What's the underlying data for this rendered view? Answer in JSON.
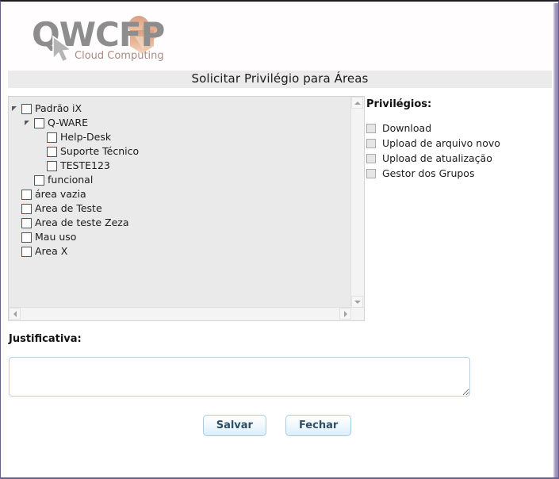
{
  "page": {
    "title": "Solicitar Privilégio para Áreas"
  },
  "logo": {
    "brand_text": "QWCFP",
    "tagline": "Cloud Computing",
    "name": "qwcfp-cloud-computing-logo"
  },
  "tree": {
    "name": "areas-tree",
    "items": [
      {
        "label": "Padrão iX",
        "depth": 0,
        "expandable": true,
        "expanded": true,
        "checked": false
      },
      {
        "label": "Q-WARE",
        "depth": 1,
        "expandable": true,
        "expanded": true,
        "checked": false
      },
      {
        "label": "Help-Desk",
        "depth": 2,
        "expandable": false,
        "expanded": false,
        "checked": false
      },
      {
        "label": "Suporte Técnico",
        "depth": 2,
        "expandable": false,
        "expanded": false,
        "checked": false
      },
      {
        "label": "TESTE123",
        "depth": 2,
        "expandable": false,
        "expanded": false,
        "checked": false
      },
      {
        "label": "funcional",
        "depth": 1,
        "expandable": false,
        "expanded": false,
        "checked": false
      },
      {
        "label": "área vazia",
        "depth": 0,
        "expandable": false,
        "expanded": false,
        "checked": false
      },
      {
        "label": "Area de Teste",
        "depth": 0,
        "expandable": false,
        "expanded": false,
        "checked": false
      },
      {
        "label": "Area de teste Zeza",
        "depth": 0,
        "expandable": false,
        "expanded": false,
        "checked": false
      },
      {
        "label": "Mau uso",
        "depth": 0,
        "expandable": false,
        "expanded": false,
        "checked": false
      },
      {
        "label": "Area X",
        "depth": 0,
        "expandable": false,
        "expanded": false,
        "checked": false
      }
    ]
  },
  "privileges": {
    "heading": "Privilégios:",
    "items": [
      {
        "label": "Download",
        "checked": false,
        "disabled": true
      },
      {
        "label": "Upload de arquivo novo",
        "checked": false,
        "disabled": true
      },
      {
        "label": "Upload de atualização",
        "checked": false,
        "disabled": true
      },
      {
        "label": "Gestor dos Grupos",
        "checked": false,
        "disabled": true
      }
    ]
  },
  "justification": {
    "label": "Justificativa:",
    "value": "",
    "placeholder": ""
  },
  "buttons": {
    "save_label": "Salvar",
    "close_label": "Fechar"
  },
  "colors": {
    "title_band": "#ebebeb",
    "tree_background": "#eaeaea",
    "checkbox_border": "#2b5f94",
    "button_text": "#2e4f66",
    "button_border": "#a8cbe2",
    "textarea_border": "#b9d2e4",
    "frame_border": "#6b5f8e"
  }
}
